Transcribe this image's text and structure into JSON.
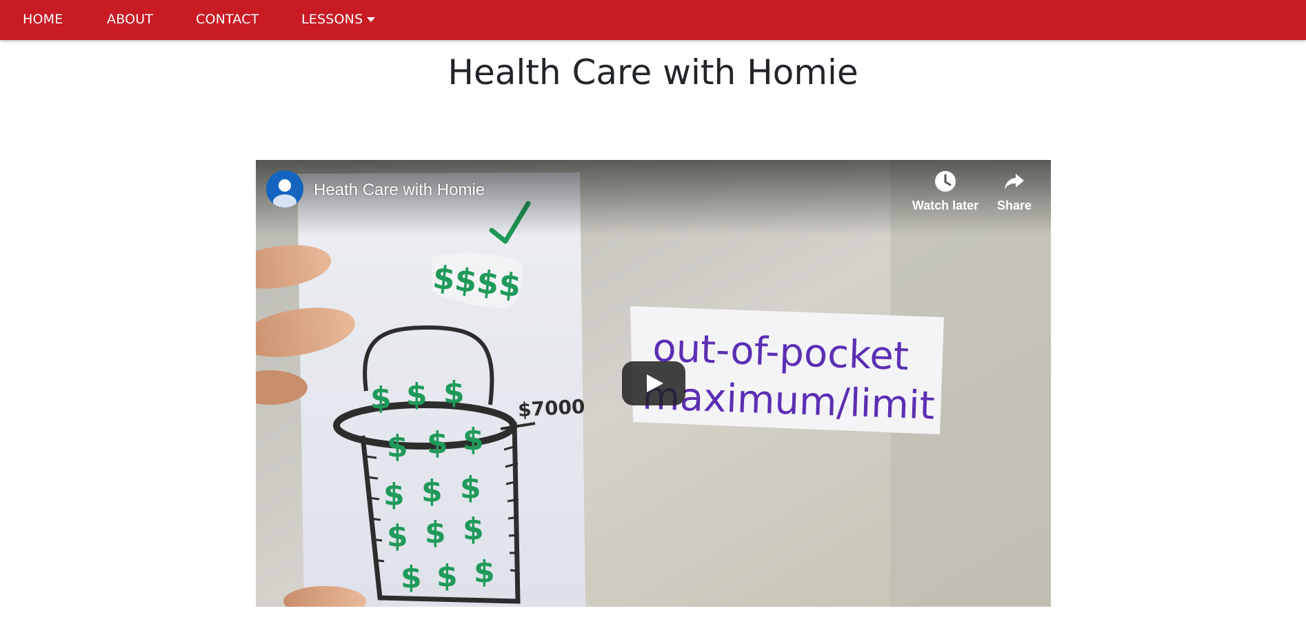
{
  "nav": {
    "items": [
      {
        "label": "HOME"
      },
      {
        "label": "ABOUT"
      },
      {
        "label": "CONTACT"
      },
      {
        "label": "LESSONS",
        "has_dropdown": true
      }
    ]
  },
  "page": {
    "title": "Health Care with Homie"
  },
  "video": {
    "title": "Heath Care with Homie",
    "watch_later_label": "Watch later",
    "share_label": "Share",
    "icons": [
      "avatar-icon",
      "clock-icon",
      "share-arrow-icon",
      "play-icon"
    ],
    "thumbnail_text": {
      "sign_line_1": "out-of-pocket",
      "sign_line_2": "maximum/limit",
      "amount": "$7000",
      "dollar_signs": "$$$$"
    }
  },
  "colors": {
    "brand_red": "#c81b24",
    "title_text": "#212529",
    "play_button": "#212121",
    "sign_ink": "#5b2fb4",
    "money_green": "#1f9a5a"
  }
}
